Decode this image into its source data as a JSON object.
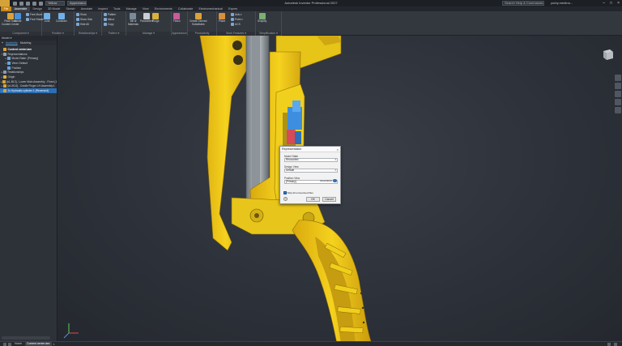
{
  "window": {
    "title": "Autodesk Inventor Professional 2027",
    "search_placeholder": "Search Help & Commands...",
    "user": "yorby.medina...",
    "qat_select": "Yellow",
    "qat_select2": "Appearance"
  },
  "tabs": [
    "File",
    "Assemble",
    "Design",
    "3D Model",
    "Sketch",
    "Annotate",
    "Inspect",
    "Tools",
    "Manage",
    "View",
    "Environments",
    "Collaborate",
    "Electromechanical",
    "Expres"
  ],
  "active_tab_index": 1,
  "ribbon": {
    "groups": [
      {
        "label": "Component ▾",
        "buttons": [
          {
            "label": "Place from\nContent Center",
            "color": "#d9a23b"
          },
          {
            "label": "Create",
            "color": "#4a90d9"
          }
        ],
        "smalls": [
          "Free Move",
          "Free Rotate"
        ]
      },
      {
        "label": "Position ▾",
        "buttons": [
          {
            "label": "Joint",
            "color": "#6fb0e8"
          },
          {
            "label": "Constrain",
            "color": "#6fb0e8"
          }
        ],
        "smalls": []
      },
      {
        "label": "Relationships ▾",
        "buttons": [],
        "smalls": [
          "Show",
          "Show Sick",
          "Hide All"
        ]
      },
      {
        "label": "Pattern ▾",
        "buttons": [],
        "smalls": [
          "Pattern",
          "Mirror",
          "Copy"
        ]
      },
      {
        "label": "Manage ▾",
        "buttons": [
          {
            "label": "Bill of\nMaterials",
            "color": "#7a8a9a"
          },
          {
            "label": "Parameters",
            "color": "#c9ced4"
          },
          {
            "label": "Purge",
            "color": "#d9b23b"
          }
        ],
        "smalls": []
      },
      {
        "label": "Appearance",
        "buttons": [
          {
            "label": "Finish",
            "color": "#c85b9a"
          }
        ],
        "smalls": []
      },
      {
        "label": "Productivity",
        "buttons": [
          {
            "label": "Create Derived\nSubstitutes",
            "color": "#d9a23b"
          }
        ],
        "smalls": []
      },
      {
        "label": "Work Features ▾",
        "buttons": [
          {
            "label": "Plane",
            "color": "#d98f3b"
          }
        ],
        "smalls": [
          "Axis ▾",
          "Point ▾",
          "UCS"
        ]
      },
      {
        "label": "Simplification ▾",
        "buttons": [
          {
            "label": "Simplify",
            "color": "#7ab070"
          }
        ],
        "smalls": []
      }
    ]
  },
  "browser": {
    "header": "Model ▾",
    "tabs": {
      "plus": "+",
      "first": "Assembly",
      "second": "Modeling"
    },
    "search_hint": "Q",
    "nodes": [
      {
        "label": "Content center.iam",
        "level": 0,
        "exp": "",
        "icon": "#d9a23b",
        "bold": true
      },
      {
        "label": "Representations",
        "level": 0,
        "exp": "▾",
        "icon": "#8fa0b5"
      },
      {
        "label": "Model State: [Primary]",
        "level": 1,
        "exp": "▸",
        "icon": "#6aa4d8"
      },
      {
        "label": "View: Default",
        "level": 1,
        "exp": "▸",
        "icon": "#6aa4d8"
      },
      {
        "label": "Position",
        "level": 1,
        "exp": "",
        "icon": "#6aa4d8"
      },
      {
        "label": "Relationships",
        "level": 0,
        "exp": "▸",
        "icon": "#8a9bb0"
      },
      {
        "label": "Origin",
        "level": 0,
        "exp": "▸",
        "icon": "#d9b23b"
      },
      {
        "label": "[a1-B13] - Lower Main Assembly - Fixed (1)",
        "level": 0,
        "exp": "▸",
        "icon": "#d9a23b"
      },
      {
        "label": "[a1-B14] - Cradle Finger LH Assembly:1",
        "level": 0,
        "exp": "▸",
        "icon": "#d9a23b"
      },
      {
        "label": "2x Hydraulic cylinder 1 (Reversed)",
        "level": 0,
        "exp": "▸",
        "icon": "#d9a23b",
        "selected": true
      }
    ]
  },
  "dialog": {
    "title": "Representation",
    "close": "×",
    "model_state_label": "Model State",
    "model_state_value": "Recounted",
    "design_view_label": "Design View",
    "design_view_value": "Default",
    "position_view_label": "Position View",
    "associative_label": "Associative",
    "position_view_value": "[Primary]",
    "checkbox_label": "Skip all unresolved files",
    "help": "?",
    "ok": "OK",
    "cancel": "Cancel"
  },
  "status": {
    "tabs": [
      "Home",
      "Content center.iam"
    ],
    "active_index": 1,
    "close": "×"
  },
  "colors": {
    "yellow_part": "#f2cc1b",
    "yellow_shadow": "#c69c10",
    "cylinder_gray": "#9aa1a6",
    "hydraulic_blue": "#3e8ee0",
    "hydraulic_red": "#d64b55",
    "accent_selection": "#2a6fb5"
  }
}
